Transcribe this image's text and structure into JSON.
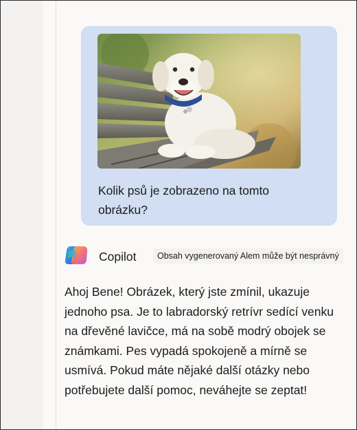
{
  "user_message": {
    "image_alt": "labrador-retriever-on-bench",
    "text": "Kolik psů je zobrazeno na tomto obrázku?"
  },
  "assistant": {
    "name": "Copilot",
    "ai_disclaimer": "Obsah vygenerovaný Alem může být nesprávný",
    "response": "Ahoj Bene! Obrázek, který jste zmínil, ukazuje jednoho psa. Je to labradorský retrívr sedící venku na dřevěné lavičce, má na sobě modrý obojek se známkami. Pes vypadá spokojeně a mírně se usmívá. Pokud máte nějaké další otázky nebo potřebujete další pomoc, neváhejte se zeptat!"
  },
  "colors": {
    "user_bubble": "#d1def3",
    "page_background": "#faf9f8",
    "text": "#1b1b1b"
  }
}
